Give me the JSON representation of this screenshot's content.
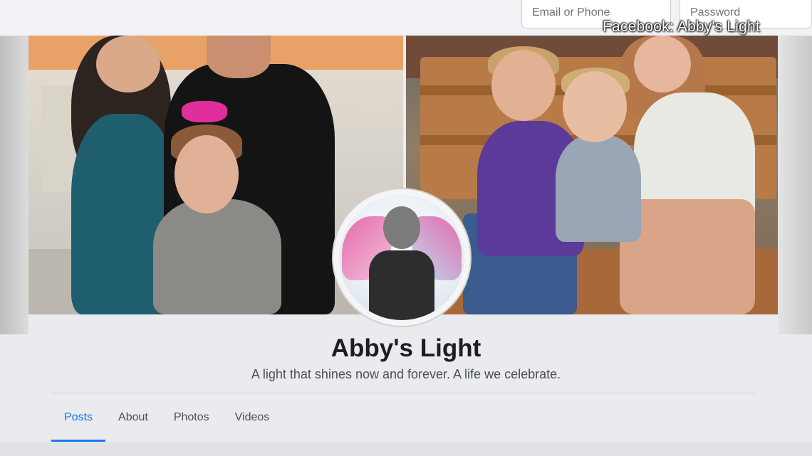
{
  "topbar": {
    "email_placeholder": "Email or Phone",
    "password_placeholder": "Password"
  },
  "watermark": "Facebook: Abby's Light",
  "page": {
    "title": "Abby's Light",
    "subtitle": "A light that shines now and forever. A life we celebrate."
  },
  "tabs": [
    {
      "label": "Posts",
      "active": true
    },
    {
      "label": "About",
      "active": false
    },
    {
      "label": "Photos",
      "active": false
    },
    {
      "label": "Videos",
      "active": false
    }
  ],
  "colors": {
    "accent": "#1877f2",
    "title": "#1c1e21",
    "background": "#e9ebee"
  }
}
